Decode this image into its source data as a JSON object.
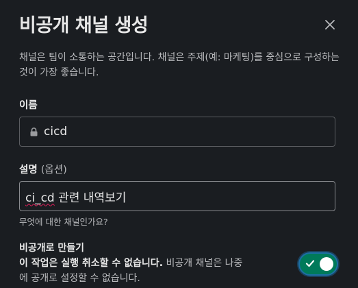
{
  "dialog": {
    "title": "비공개 채널 생성",
    "close_icon": "close-icon",
    "description": "채널은 팀이 소통하는 공간입니다. 채널은 주제(예: 마케팅)를 중심으로 구성하는 것이 가장 좋습니다."
  },
  "name_field": {
    "label": "이름",
    "icon": "lock-icon",
    "value": "cicd"
  },
  "purpose_field": {
    "label": "설명",
    "optional": "(옵션)",
    "value_misspelled": "ci_cd",
    "value_rest": " 관련 내역보기",
    "hint": "무엇에 대한 채널인가요?"
  },
  "private_toggle": {
    "title": "비공개로 만들기",
    "warning": "이 작업은 실행 취소할 수 없습니다.",
    "detail": " 비공개 채널은 나중에 공개로 설정할 수 없습니다.",
    "enabled": true,
    "accent_color": "#007a5a",
    "focus_color": "#1d6fa5"
  }
}
